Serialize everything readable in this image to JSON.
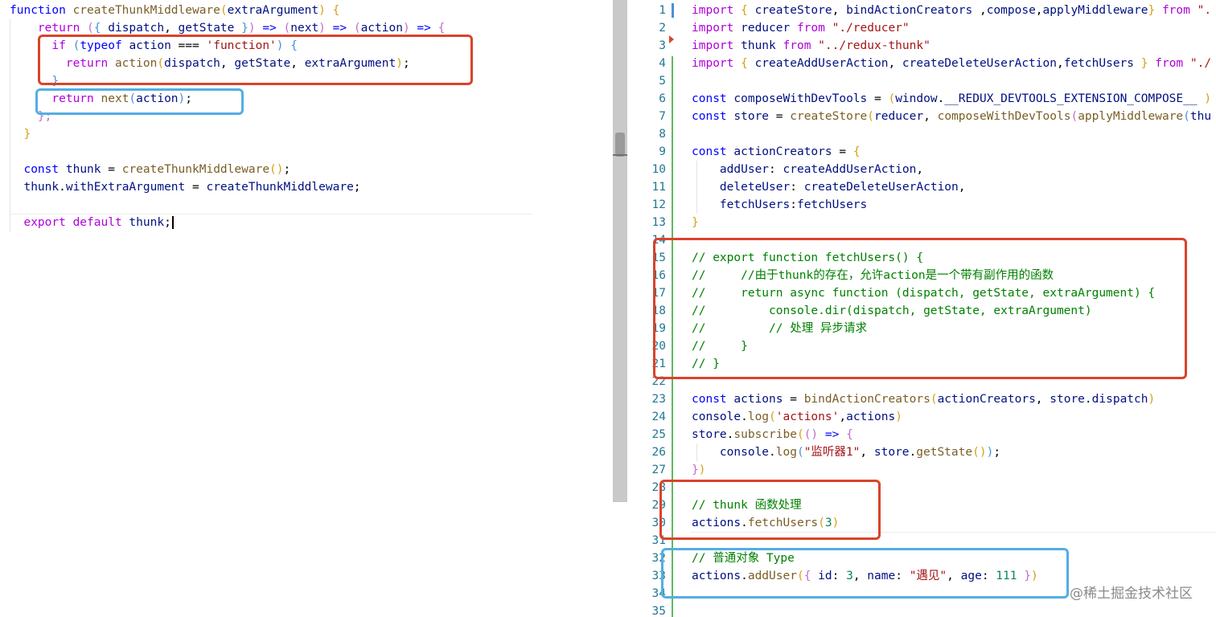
{
  "left_editor": {
    "lines": [
      {
        "tokens": [
          {
            "t": "function ",
            "c": "kw"
          },
          {
            "t": "createThunkMiddleware",
            "c": "fn"
          },
          {
            "t": "(",
            "c": "b1"
          },
          {
            "t": "extraArgument",
            "c": "id"
          },
          {
            "t": ") ",
            "c": "b1"
          },
          {
            "t": "{",
            "c": "b1"
          }
        ]
      },
      {
        "tokens": [
          {
            "t": "    "
          },
          {
            "t": "return ",
            "c": "kw2"
          },
          {
            "t": "(",
            "c": "b2"
          },
          {
            "t": "{ ",
            "c": "b3"
          },
          {
            "t": "dispatch",
            "c": "id"
          },
          {
            "t": ", "
          },
          {
            "t": "getState",
            "c": "id"
          },
          {
            "t": " }",
            "c": "b3"
          },
          {
            "t": ")",
            "c": "b2"
          },
          {
            "t": " => ",
            "c": "kw"
          },
          {
            "t": "(",
            "c": "b2"
          },
          {
            "t": "next",
            "c": "id"
          },
          {
            "t": ")",
            "c": "b2"
          },
          {
            "t": " => ",
            "c": "kw"
          },
          {
            "t": "(",
            "c": "b2"
          },
          {
            "t": "action",
            "c": "id"
          },
          {
            "t": ")",
            "c": "b2"
          },
          {
            "t": " => ",
            "c": "kw"
          },
          {
            "t": "{",
            "c": "b2"
          }
        ]
      },
      {
        "tokens": [
          {
            "t": "      "
          },
          {
            "t": "if ",
            "c": "kw2"
          },
          {
            "t": "(",
            "c": "b3"
          },
          {
            "t": "typeof ",
            "c": "kw"
          },
          {
            "t": "action",
            "c": "id"
          },
          {
            "t": " === "
          },
          {
            "t": "'function'",
            "c": "str"
          },
          {
            "t": ") ",
            "c": "b3"
          },
          {
            "t": "{",
            "c": "b3"
          }
        ]
      },
      {
        "tokens": [
          {
            "t": "        "
          },
          {
            "t": "return ",
            "c": "kw2"
          },
          {
            "t": "action",
            "c": "fn"
          },
          {
            "t": "(",
            "c": "b1"
          },
          {
            "t": "dispatch",
            "c": "id"
          },
          {
            "t": ", "
          },
          {
            "t": "getState",
            "c": "id"
          },
          {
            "t": ", "
          },
          {
            "t": "extraArgument",
            "c": "id"
          },
          {
            "t": ")",
            "c": "b1"
          },
          {
            "t": ";"
          }
        ]
      },
      {
        "tokens": [
          {
            "t": "      "
          },
          {
            "t": "}",
            "c": "b3"
          }
        ]
      },
      {
        "tokens": [
          {
            "t": "      "
          },
          {
            "t": "return ",
            "c": "kw2"
          },
          {
            "t": "next",
            "c": "fn"
          },
          {
            "t": "(",
            "c": "b3"
          },
          {
            "t": "action",
            "c": "id"
          },
          {
            "t": ")",
            "c": "b3"
          },
          {
            "t": ";"
          }
        ]
      },
      {
        "tokens": [
          {
            "t": "    "
          },
          {
            "t": "};",
            "c": "b2"
          }
        ]
      },
      {
        "tokens": [
          {
            "t": "  "
          },
          {
            "t": "}",
            "c": "b1"
          }
        ]
      },
      {
        "tokens": []
      },
      {
        "tokens": [
          {
            "t": "  "
          },
          {
            "t": "const ",
            "c": "kw"
          },
          {
            "t": "thunk",
            "c": "id"
          },
          {
            "t": " = "
          },
          {
            "t": "createThunkMiddleware",
            "c": "fn"
          },
          {
            "t": "()",
            "c": "b1"
          },
          {
            "t": ";"
          }
        ]
      },
      {
        "tokens": [
          {
            "t": "  "
          },
          {
            "t": "thunk",
            "c": "id"
          },
          {
            "t": "."
          },
          {
            "t": "withExtraArgument",
            "c": "id"
          },
          {
            "t": " = "
          },
          {
            "t": "createThunkMiddleware",
            "c": "id"
          },
          {
            "t": ";"
          }
        ]
      },
      {
        "tokens": []
      },
      {
        "tokens": [
          {
            "t": "  "
          },
          {
            "t": "export ",
            "c": "kw2"
          },
          {
            "t": "default ",
            "c": "kw2"
          },
          {
            "t": "thunk",
            "c": "id"
          },
          {
            "t": ";"
          }
        ]
      }
    ]
  },
  "right_editor": {
    "line_numbers": [
      "1",
      "2",
      "3",
      "4",
      "5",
      "6",
      "7",
      "8",
      "9",
      "10",
      "11",
      "12",
      "13",
      "14",
      "15",
      "16",
      "17",
      "18",
      "19",
      "20",
      "21",
      "22",
      "23",
      "24",
      "25",
      "26",
      "27",
      "28",
      "29",
      "30",
      "31",
      "32",
      "33",
      "34",
      "35"
    ],
    "lines": [
      {
        "tokens": [
          {
            "t": "import ",
            "c": "kw2"
          },
          {
            "t": "{ ",
            "c": "b1"
          },
          {
            "t": "createStore",
            "c": "id"
          },
          {
            "t": ", "
          },
          {
            "t": "bindActionCreators",
            "c": "id"
          },
          {
            "t": " ,"
          },
          {
            "t": "compose",
            "c": "id"
          },
          {
            "t": ","
          },
          {
            "t": "applyMiddleware",
            "c": "id"
          },
          {
            "t": "} ",
            "c": "b1"
          },
          {
            "t": "from ",
            "c": "kw2"
          },
          {
            "t": "\".",
            "c": "str"
          }
        ]
      },
      {
        "tokens": [
          {
            "t": "import ",
            "c": "kw2"
          },
          {
            "t": "reducer",
            "c": "id"
          },
          {
            "t": " "
          },
          {
            "t": "from ",
            "c": "kw2"
          },
          {
            "t": "\"./reducer\"",
            "c": "str"
          }
        ]
      },
      {
        "tokens": [
          {
            "t": "import ",
            "c": "kw2"
          },
          {
            "t": "thunk",
            "c": "id"
          },
          {
            "t": " "
          },
          {
            "t": "from ",
            "c": "kw2"
          },
          {
            "t": "\"../redux-thunk\"",
            "c": "str"
          }
        ]
      },
      {
        "tokens": [
          {
            "t": "import ",
            "c": "kw2"
          },
          {
            "t": "{ ",
            "c": "b1"
          },
          {
            "t": "createAddUserAction",
            "c": "id"
          },
          {
            "t": ", "
          },
          {
            "t": "createDeleteUserAction",
            "c": "id"
          },
          {
            "t": ","
          },
          {
            "t": "fetchUsers",
            "c": "id"
          },
          {
            "t": " } ",
            "c": "b1"
          },
          {
            "t": "from ",
            "c": "kw2"
          },
          {
            "t": "\"./",
            "c": "str"
          }
        ]
      },
      {
        "tokens": []
      },
      {
        "tokens": [
          {
            "t": "const ",
            "c": "kw"
          },
          {
            "t": "composeWithDevTools",
            "c": "id"
          },
          {
            "t": " = "
          },
          {
            "t": "(",
            "c": "b1"
          },
          {
            "t": "window",
            "c": "id"
          },
          {
            "t": "."
          },
          {
            "t": "__REDUX_DEVTOOLS_EXTENSION_COMPOSE__",
            "c": "id"
          },
          {
            "t": " ) ",
            "c": "b1"
          }
        ]
      },
      {
        "tokens": [
          {
            "t": "const ",
            "c": "kw"
          },
          {
            "t": "store",
            "c": "id"
          },
          {
            "t": " = "
          },
          {
            "t": "createStore",
            "c": "fn"
          },
          {
            "t": "(",
            "c": "b1"
          },
          {
            "t": "reducer",
            "c": "id"
          },
          {
            "t": ", "
          },
          {
            "t": "composeWithDevTools",
            "c": "fn"
          },
          {
            "t": "(",
            "c": "b2"
          },
          {
            "t": "applyMiddleware",
            "c": "fn"
          },
          {
            "t": "(",
            "c": "b3"
          },
          {
            "t": "thu",
            "c": "id"
          }
        ]
      },
      {
        "tokens": []
      },
      {
        "tokens": [
          {
            "t": "const ",
            "c": "kw"
          },
          {
            "t": "actionCreators",
            "c": "id"
          },
          {
            "t": " = "
          },
          {
            "t": "{",
            "c": "b1"
          }
        ]
      },
      {
        "tokens": [
          {
            "t": "    "
          },
          {
            "t": "addUser",
            "c": "id"
          },
          {
            "t": ": "
          },
          {
            "t": "createAddUserAction",
            "c": "id"
          },
          {
            "t": ","
          }
        ]
      },
      {
        "tokens": [
          {
            "t": "    "
          },
          {
            "t": "deleteUser",
            "c": "id"
          },
          {
            "t": ": "
          },
          {
            "t": "createDeleteUserAction",
            "c": "id"
          },
          {
            "t": ","
          }
        ]
      },
      {
        "tokens": [
          {
            "t": "    "
          },
          {
            "t": "fetchUsers",
            "c": "id"
          },
          {
            "t": ":"
          },
          {
            "t": "fetchUsers",
            "c": "id"
          }
        ]
      },
      {
        "tokens": [
          {
            "t": "}",
            "c": "b1"
          }
        ]
      },
      {
        "tokens": []
      },
      {
        "tokens": [
          {
            "t": "// export function fetchUsers() {",
            "c": "cm"
          }
        ]
      },
      {
        "tokens": [
          {
            "t": "//     //由于thunk的存在，允许action是一个带有副作用的函数",
            "c": "cm"
          }
        ]
      },
      {
        "tokens": [
          {
            "t": "//     return async function (dispatch, getState, extraArgument) {",
            "c": "cm"
          }
        ]
      },
      {
        "tokens": [
          {
            "t": "//         console.dir(dispatch, getState, extraArgument)",
            "c": "cm"
          }
        ]
      },
      {
        "tokens": [
          {
            "t": "//         // 处理 异步请求",
            "c": "cm"
          }
        ]
      },
      {
        "tokens": [
          {
            "t": "//     }",
            "c": "cm"
          }
        ]
      },
      {
        "tokens": [
          {
            "t": "// }",
            "c": "cm"
          }
        ]
      },
      {
        "tokens": []
      },
      {
        "tokens": [
          {
            "t": "const ",
            "c": "kw"
          },
          {
            "t": "actions",
            "c": "id"
          },
          {
            "t": " = "
          },
          {
            "t": "bindActionCreators",
            "c": "fn"
          },
          {
            "t": "(",
            "c": "b1"
          },
          {
            "t": "actionCreators",
            "c": "id"
          },
          {
            "t": ", "
          },
          {
            "t": "store",
            "c": "id"
          },
          {
            "t": "."
          },
          {
            "t": "dispatch",
            "c": "id"
          },
          {
            "t": ")",
            "c": "b1"
          }
        ]
      },
      {
        "tokens": [
          {
            "t": "console",
            "c": "id"
          },
          {
            "t": "."
          },
          {
            "t": "log",
            "c": "fn"
          },
          {
            "t": "(",
            "c": "b1"
          },
          {
            "t": "'actions'",
            "c": "str"
          },
          {
            "t": ","
          },
          {
            "t": "actions",
            "c": "id"
          },
          {
            "t": ")",
            "c": "b1"
          }
        ]
      },
      {
        "tokens": [
          {
            "t": "store",
            "c": "id"
          },
          {
            "t": "."
          },
          {
            "t": "subscribe",
            "c": "fn"
          },
          {
            "t": "(",
            "c": "b1"
          },
          {
            "t": "()",
            "c": "b2"
          },
          {
            "t": " => ",
            "c": "kw"
          },
          {
            "t": "{",
            "c": "b2"
          }
        ]
      },
      {
        "tokens": [
          {
            "t": "    "
          },
          {
            "t": "console",
            "c": "id"
          },
          {
            "t": "."
          },
          {
            "t": "log",
            "c": "fn"
          },
          {
            "t": "(",
            "c": "b3"
          },
          {
            "t": "\"监听器1\"",
            "c": "str"
          },
          {
            "t": ", "
          },
          {
            "t": "store",
            "c": "id"
          },
          {
            "t": "."
          },
          {
            "t": "getState",
            "c": "fn"
          },
          {
            "t": "()",
            "c": "b1"
          },
          {
            "t": ")",
            "c": "b3"
          },
          {
            "t": ";"
          }
        ]
      },
      {
        "tokens": [
          {
            "t": "}",
            "c": "b2"
          },
          {
            "t": ")",
            "c": "b1"
          }
        ]
      },
      {
        "tokens": []
      },
      {
        "tokens": [
          {
            "t": "// thunk 函数处理",
            "c": "cm"
          }
        ]
      },
      {
        "tokens": [
          {
            "t": "actions",
            "c": "id"
          },
          {
            "t": "."
          },
          {
            "t": "fetchUsers",
            "c": "fn"
          },
          {
            "t": "(",
            "c": "b1"
          },
          {
            "t": "3",
            "c": "num"
          },
          {
            "t": ")",
            "c": "b1"
          }
        ]
      },
      {
        "tokens": []
      },
      {
        "tokens": [
          {
            "t": "// 普通对象 Type",
            "c": "cm"
          }
        ]
      },
      {
        "tokens": [
          {
            "t": "actions",
            "c": "id"
          },
          {
            "t": "."
          },
          {
            "t": "addUser",
            "c": "fn"
          },
          {
            "t": "(",
            "c": "b1"
          },
          {
            "t": "{ ",
            "c": "b2"
          },
          {
            "t": "id",
            "c": "id"
          },
          {
            "t": ": "
          },
          {
            "t": "3",
            "c": "num"
          },
          {
            "t": ", "
          },
          {
            "t": "name",
            "c": "id"
          },
          {
            "t": ": "
          },
          {
            "t": "\"遇见\"",
            "c": "str"
          },
          {
            "t": ", "
          },
          {
            "t": "age",
            "c": "id"
          },
          {
            "t": ": "
          },
          {
            "t": "111",
            "c": "num"
          },
          {
            "t": " }",
            "c": "b2"
          },
          {
            "t": ")",
            "c": "b1"
          }
        ]
      },
      {
        "tokens": []
      },
      {
        "tokens": []
      }
    ]
  },
  "watermark": "@稀土掘金技术社区"
}
